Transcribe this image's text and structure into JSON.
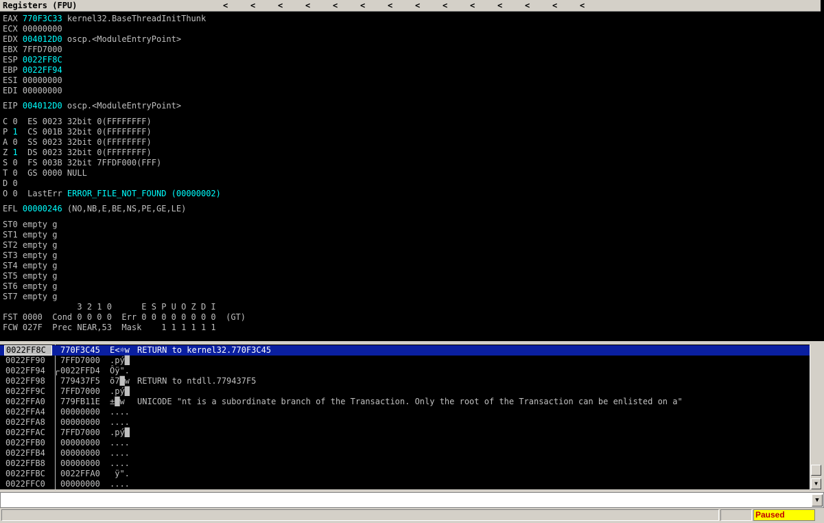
{
  "registers_panel": {
    "title": "Registers (FPU)",
    "arrow_glyph": "<",
    "arrow_count": 14,
    "lines": [
      {
        "t": 20,
        "segs": [
          [
            "EAX ",
            0
          ],
          [
            "770F3C33",
            1
          ],
          [
            " kernel32.BaseThreadInitThunk",
            0
          ]
        ]
      },
      {
        "t": 35,
        "segs": [
          [
            "ECX 00000000",
            0
          ]
        ]
      },
      {
        "t": 50,
        "segs": [
          [
            "EDX ",
            0
          ],
          [
            "004012D0",
            1
          ],
          [
            " oscp.<ModuleEntryPoint>",
            0
          ]
        ]
      },
      {
        "t": 65,
        "segs": [
          [
            "EBX 7FFD7000",
            0
          ]
        ]
      },
      {
        "t": 80,
        "segs": [
          [
            "ESP ",
            0
          ],
          [
            "0022FF8C",
            1
          ]
        ]
      },
      {
        "t": 95,
        "segs": [
          [
            "EBP ",
            0
          ],
          [
            "0022FF94",
            1
          ]
        ]
      },
      {
        "t": 110,
        "segs": [
          [
            "ESI 00000000",
            0
          ]
        ]
      },
      {
        "t": 125,
        "segs": [
          [
            "EDI 00000000",
            0
          ]
        ]
      },
      {
        "t": 147,
        "segs": [
          [
            "EIP ",
            0
          ],
          [
            "004012D0",
            1
          ],
          [
            " oscp.<ModuleEntryPoint>",
            0
          ]
        ]
      },
      {
        "t": 170,
        "segs": [
          [
            "C 0  ES 0023 32bit 0(FFFFFFFF)",
            0
          ]
        ]
      },
      {
        "t": 185,
        "segs": [
          [
            "P ",
            0
          ],
          [
            "1",
            1
          ],
          [
            "  CS 001B 32bit 0(FFFFFFFF)",
            0
          ]
        ]
      },
      {
        "t": 200,
        "segs": [
          [
            "A 0  SS 0023 32bit 0(FFFFFFFF)",
            0
          ]
        ]
      },
      {
        "t": 215,
        "segs": [
          [
            "Z ",
            0
          ],
          [
            "1",
            1
          ],
          [
            "  DS 0023 32bit 0(FFFFFFFF)",
            0
          ]
        ]
      },
      {
        "t": 230,
        "segs": [
          [
            "S 0  FS 003B 32bit 7FFDF000(FFF)",
            0
          ]
        ]
      },
      {
        "t": 245,
        "segs": [
          [
            "T 0  GS 0000 NULL",
            0
          ]
        ]
      },
      {
        "t": 260,
        "segs": [
          [
            "D 0",
            0
          ]
        ]
      },
      {
        "t": 275,
        "segs": [
          [
            "O 0  LastErr ",
            0
          ],
          [
            "ERROR_FILE_NOT_FOUND (00000002)",
            1
          ]
        ]
      },
      {
        "t": 297,
        "segs": [
          [
            "EFL ",
            0
          ],
          [
            "00000246",
            1
          ],
          [
            " (NO,NB,E,BE,NS,PE,GE,LE)",
            0
          ]
        ]
      },
      {
        "t": 320,
        "segs": [
          [
            "ST0 empty g",
            0
          ]
        ]
      },
      {
        "t": 335,
        "segs": [
          [
            "ST1 empty g",
            0
          ]
        ]
      },
      {
        "t": 350,
        "segs": [
          [
            "ST2 empty g",
            0
          ]
        ]
      },
      {
        "t": 365,
        "segs": [
          [
            "ST3 empty g",
            0
          ]
        ]
      },
      {
        "t": 380,
        "segs": [
          [
            "ST4 empty g",
            0
          ]
        ]
      },
      {
        "t": 395,
        "segs": [
          [
            "ST5 empty g",
            0
          ]
        ]
      },
      {
        "t": 410,
        "segs": [
          [
            "ST6 empty g",
            0
          ]
        ]
      },
      {
        "t": 425,
        "segs": [
          [
            "ST7 empty g",
            0
          ]
        ]
      },
      {
        "t": 440,
        "segs": [
          [
            "               3 2 1 0      E S P U O Z D I",
            0
          ]
        ]
      },
      {
        "t": 455,
        "segs": [
          [
            "FST 0000  Cond 0 0 0 0  Err 0 0 0 0 0 0 0 0  (GT)",
            0
          ]
        ]
      },
      {
        "t": 470,
        "segs": [
          [
            "FCW 027F  Prec NEAR,53  Mask    1 1 1 1 1 1",
            0
          ]
        ]
      }
    ]
  },
  "stack_panel": {
    "rows": [
      {
        "addr": "0022FF8C",
        "val": "770F3C45",
        "ascii": "E<☼w",
        "comment": "RETURN to kernel32.770F3C45",
        "selected": true
      },
      {
        "addr": "0022FF90",
        "val": "7FFD7000",
        "ascii": ".pý█",
        "comment": ""
      },
      {
        "addr": "0022FF94",
        "val": "0022FFD4",
        "ascii": "Ôÿ\".",
        "comment": "",
        "bracket": true
      },
      {
        "addr": "0022FF98",
        "val": "779437F5",
        "ascii": "õ7█w",
        "comment": "RETURN to ntdll.779437F5"
      },
      {
        "addr": "0022FF9C",
        "val": "7FFD7000",
        "ascii": ".pý█",
        "comment": ""
      },
      {
        "addr": "0022FFA0",
        "val": "779FB11E",
        "ascii": "±█w",
        "comment": "UNICODE \"nt is a subordinate branch of the Transaction. Only the root of the Transaction can be enlisted on a\""
      },
      {
        "addr": "0022FFA4",
        "val": "00000000",
        "ascii": "....",
        "comment": ""
      },
      {
        "addr": "0022FFA8",
        "val": "00000000",
        "ascii": "....",
        "comment": ""
      },
      {
        "addr": "0022FFAC",
        "val": "7FFD7000",
        "ascii": ".pý█",
        "comment": ""
      },
      {
        "addr": "0022FFB0",
        "val": "00000000",
        "ascii": "....",
        "comment": ""
      },
      {
        "addr": "0022FFB4",
        "val": "00000000",
        "ascii": "....",
        "comment": ""
      },
      {
        "addr": "0022FFB8",
        "val": "00000000",
        "ascii": "....",
        "comment": ""
      },
      {
        "addr": "0022FFBC",
        "val": "0022FFA0",
        "ascii": " ÿ\".",
        "comment": ""
      },
      {
        "addr": "0022FFC0",
        "val": "00000000",
        "ascii": "....",
        "comment": ""
      }
    ]
  },
  "command_bar": {
    "value": ""
  },
  "status_bar": {
    "state": "Paused"
  },
  "colors": {
    "highlight": "#00ffff",
    "selection": "#0a1fa0",
    "paused_bg": "#ffff00",
    "paused_fg": "#c00000"
  }
}
